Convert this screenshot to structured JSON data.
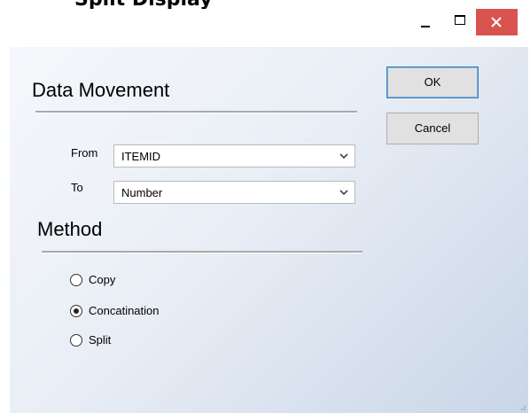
{
  "window": {
    "title_fragment": "Split Display",
    "controls": {
      "minimize_icon": "minimize-icon",
      "maximize_icon": "maximize-icon",
      "close_icon": "close-icon",
      "close_color": "#d9534f"
    }
  },
  "dialog": {
    "heading": "Data Movement",
    "from": {
      "label": "From",
      "value": "ITEMID"
    },
    "to": {
      "label": "To",
      "value": "Number"
    },
    "method": {
      "heading": "Method",
      "options": [
        {
          "label": "Copy",
          "selected": false
        },
        {
          "label": "Concatination",
          "selected": true
        },
        {
          "label": "Split",
          "selected": false
        }
      ]
    },
    "buttons": {
      "ok": "OK",
      "cancel": "Cancel"
    }
  },
  "colors": {
    "gradient_start": "#f5f7fb",
    "gradient_end": "#c9d6e7",
    "default_button_border": "#3c7fb1"
  }
}
